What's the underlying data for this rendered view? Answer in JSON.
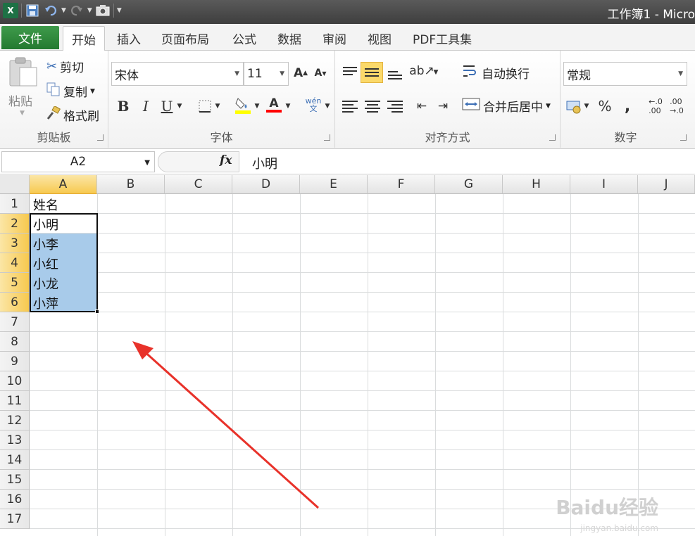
{
  "titlebar": {
    "title": "工作簿1 - Micro",
    "qat": [
      "excel-logo",
      "save-icon",
      "undo-icon",
      "redo-icon",
      "camera-icon"
    ]
  },
  "tabs": {
    "file": "文件",
    "items": [
      "开始",
      "插入",
      "页面布局",
      "公式",
      "数据",
      "审阅",
      "视图",
      "PDF工具集"
    ],
    "active": "开始"
  },
  "ribbon": {
    "clipboard": {
      "label": "剪贴板",
      "paste": "粘贴",
      "cut": "剪切",
      "copy": "复制",
      "format_painter": "格式刷"
    },
    "font": {
      "label": "字体",
      "font_name": "宋体",
      "font_size": "11",
      "bold": "B",
      "italic": "I",
      "underline": "U",
      "font_color_glyph": "A",
      "phonetic_glyph": "wén 文",
      "colors": {
        "fill": "#ffff00",
        "font": "#ff0000"
      }
    },
    "alignment": {
      "label": "对齐方式",
      "wrap_text": "自动换行",
      "merge_center": "合并后居中"
    },
    "number": {
      "label": "数字",
      "format": "常规",
      "percent": "%",
      "comma": ","
    }
  },
  "formula_bar": {
    "name_box": "A2",
    "fx": "fx",
    "content": "小明"
  },
  "sheet": {
    "columns": [
      "A",
      "B",
      "C",
      "D",
      "E",
      "F",
      "G",
      "H",
      "I",
      "J"
    ],
    "rows": [
      "1",
      "2",
      "3",
      "4",
      "5",
      "6",
      "7",
      "8",
      "9",
      "10",
      "11",
      "12",
      "13",
      "14",
      "15",
      "16",
      "17"
    ],
    "cells": [
      "姓名",
      "小明",
      "小李",
      "小红",
      "小龙",
      "小萍"
    ],
    "selected_range": "A2:A6",
    "selection_color": "#a8cbea"
  },
  "watermark": {
    "text": "Baidu经验",
    "sub": "jingyan.baidu.com"
  }
}
